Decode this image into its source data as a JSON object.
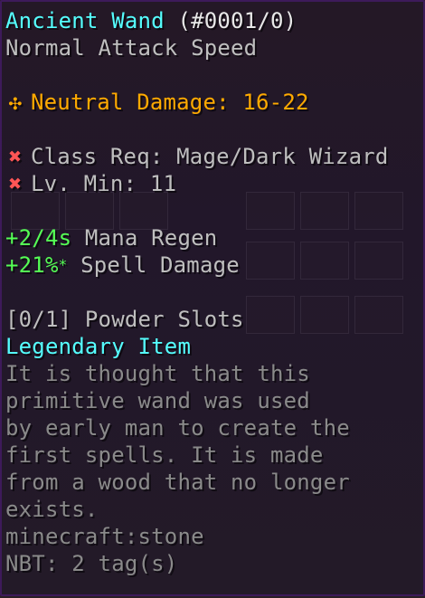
{
  "item": {
    "name": "Ancient Wand",
    "id": "(#0001/0)",
    "attack_speed": "Normal Attack Speed",
    "damage": {
      "icon": "neutral-damage-icon",
      "text": "Neutral Damage: 16-22"
    },
    "requirements": [
      {
        "icon": "cross-icon",
        "text": "Class Req: Mage/Dark Wizard"
      },
      {
        "icon": "cross-icon",
        "text": "Lv. Min: 11"
      }
    ],
    "identifications": [
      {
        "value": "+2/4s",
        "label": "Mana Regen"
      },
      {
        "value": "+21%",
        "suffix": "*",
        "label": "Spell Damage"
      }
    ],
    "powder_slots": "[0/1] Powder Slots",
    "tier": "Legendary Item",
    "lore": [
      "It is thought that this",
      "primitive wand was used",
      "by early man to create the",
      "first spells. It is made",
      "from a wood that no longer",
      "exists."
    ],
    "debug_id": "minecraft:stone",
    "nbt": "NBT: 2 tag(s)"
  },
  "colors": {
    "name": "#55ffff",
    "damage": "#ffaa00",
    "requirement_fail": "#ff5555",
    "positive": "#55ff55",
    "tier": "#55ffff",
    "lore": "#8a8a8a"
  }
}
